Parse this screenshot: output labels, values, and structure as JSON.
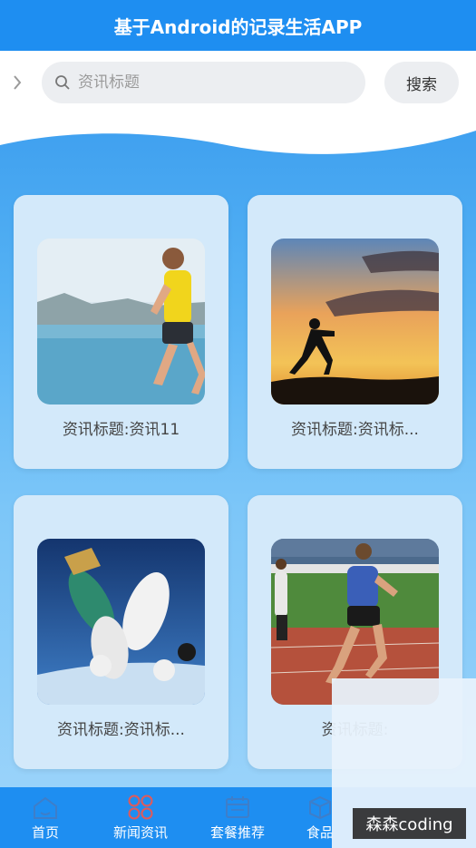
{
  "app": {
    "title": "基于Android的记录生活APP"
  },
  "search": {
    "placeholder": "资讯标题",
    "value": "",
    "button_label": "搜索"
  },
  "news_cards": [
    {
      "title": "资讯标题:资讯11",
      "image": "runner-by-lake-photo"
    },
    {
      "title": "资讯标题:资讯标...",
      "image": "sprinter-silhouette-sunset-photo"
    },
    {
      "title": "资讯标题:资讯标...",
      "image": "skydivers-formation-photo"
    },
    {
      "title": "资讯标题:",
      "image": "track-runners-photo"
    }
  ],
  "tabbar": {
    "items": [
      {
        "label": "首页",
        "icon": "home-icon"
      },
      {
        "label": "新闻资讯",
        "icon": "grid-circles-icon",
        "active": true
      },
      {
        "label": "套餐推荐",
        "icon": "calendar-icon"
      },
      {
        "label": "食品",
        "icon": "box-icon"
      }
    ]
  },
  "watermark": {
    "text": "森森coding"
  },
  "colors": {
    "primary": "#1e8ef1",
    "active_tab_icon": "#e05a5a",
    "card_bg": "#d3e9fa"
  }
}
